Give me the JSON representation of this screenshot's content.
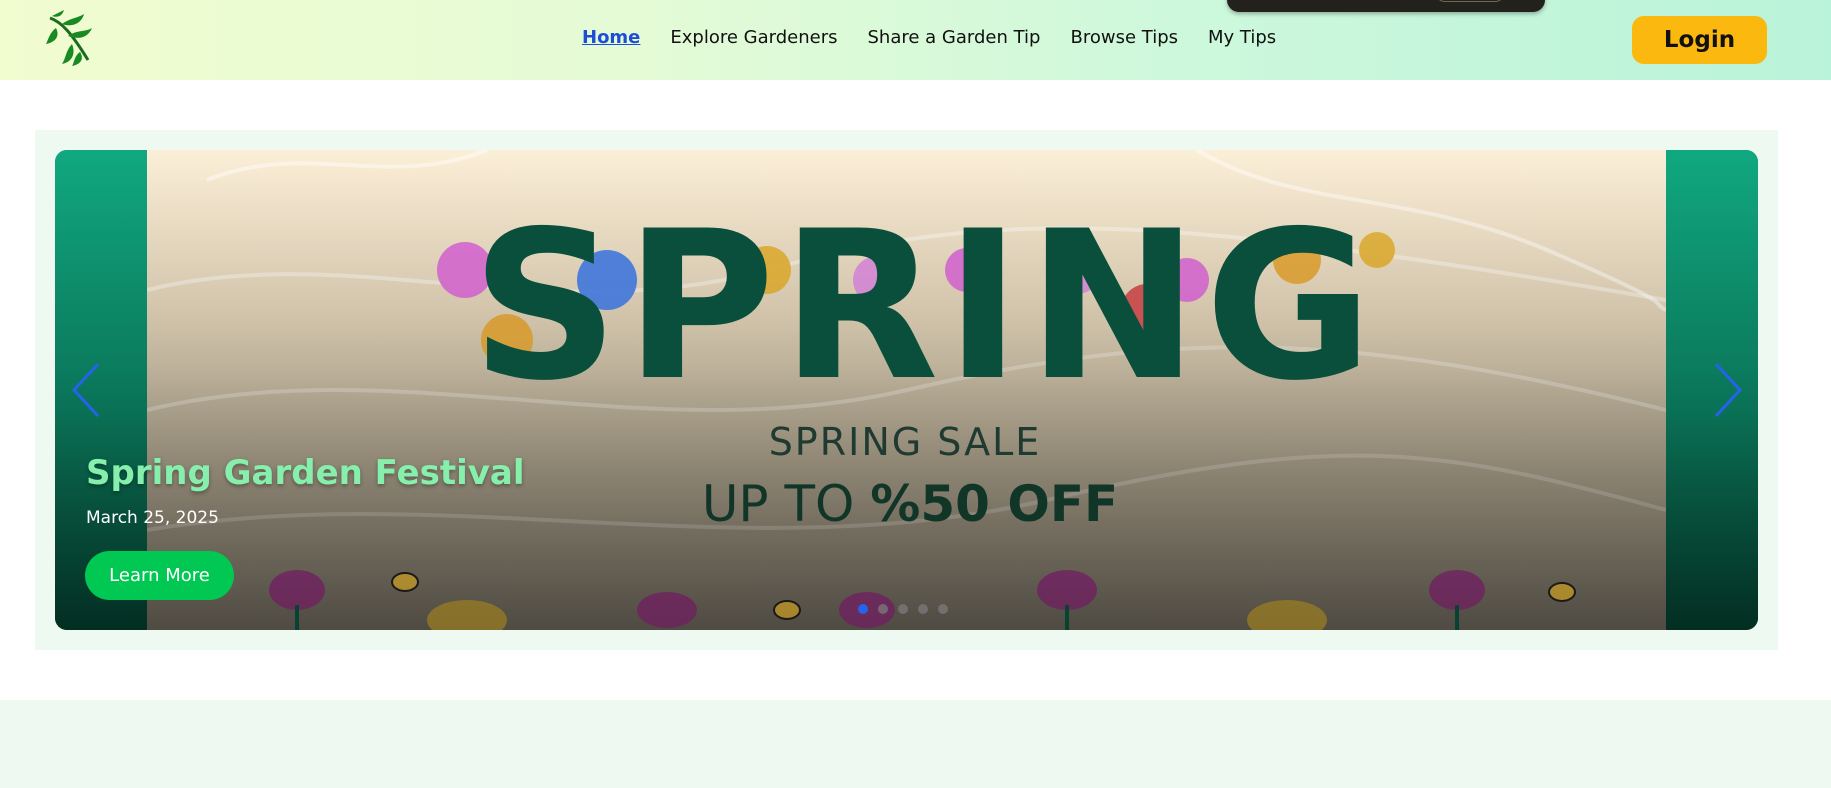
{
  "header": {
    "logo_icon": "branch-leaves-icon",
    "nav": [
      {
        "label": "Home",
        "active": true
      },
      {
        "label": "Explore Gardeners",
        "active": false
      },
      {
        "label": "Share a Garden Tip",
        "active": false
      },
      {
        "label": "Browse Tips",
        "active": false
      },
      {
        "label": "My Tips",
        "active": false
      }
    ],
    "login_label": "Login",
    "accent_color": "#fbb80f"
  },
  "carousel": {
    "banner": {
      "headline": "SPRING",
      "sale_line": "SPRING SALE",
      "discount_prefix": "UP TO ",
      "discount_value": "%50 OFF"
    },
    "slide": {
      "title": "Spring Garden Festival",
      "date": "March 25, 2025",
      "cta_label": "Learn More"
    },
    "prev_icon": "chevron-left-icon",
    "next_icon": "chevron-right-icon",
    "dot_count": 5,
    "active_dot": 1,
    "title_color": "#86efac",
    "cta_color": "#00c853"
  }
}
